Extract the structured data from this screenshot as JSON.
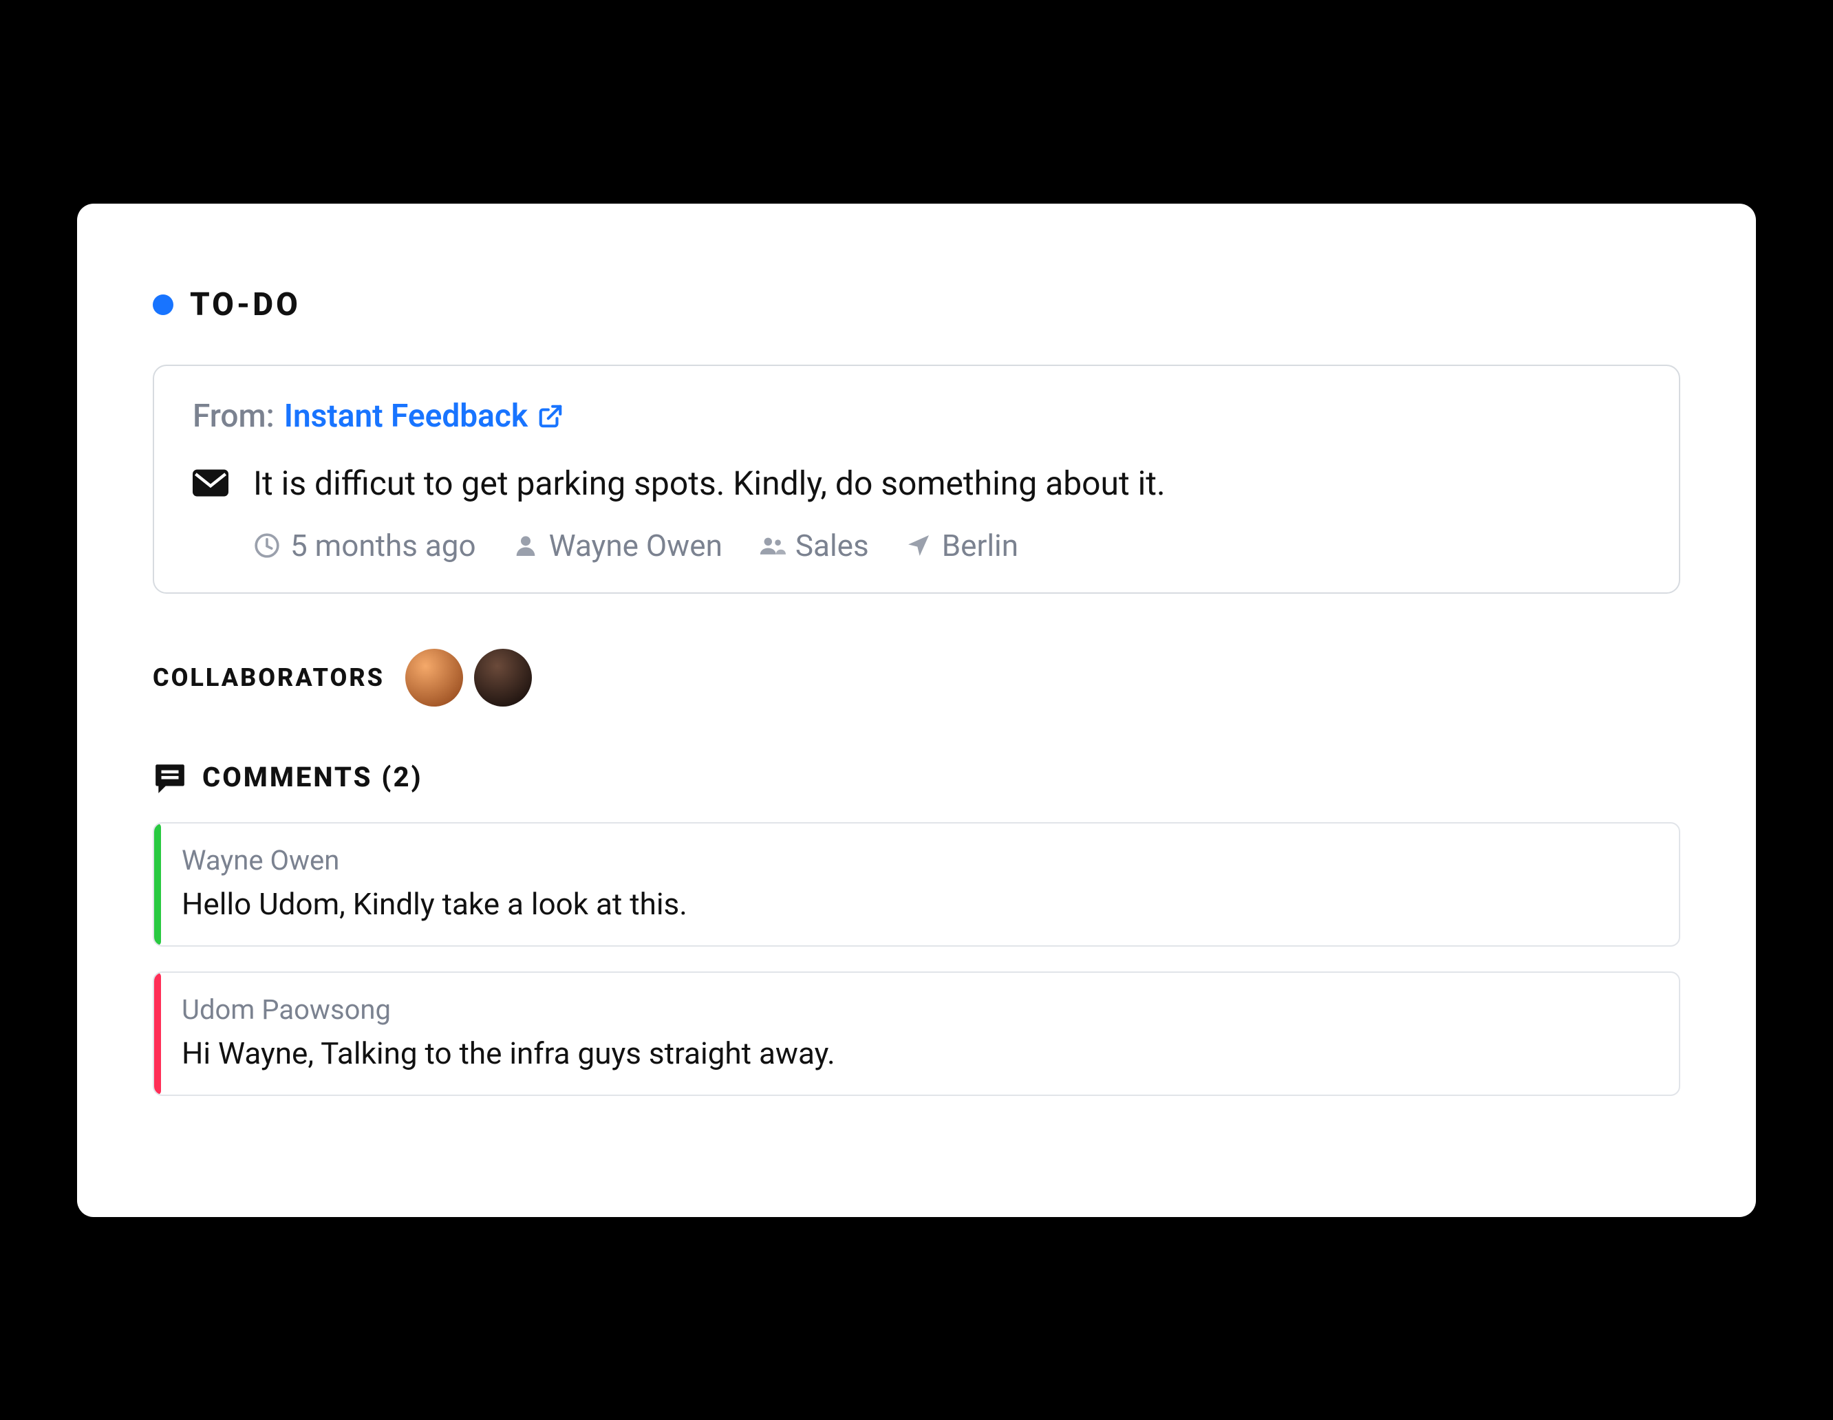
{
  "section": {
    "title": "TO-DO",
    "status_color": "#1874ff"
  },
  "feedback": {
    "from_label": "From:",
    "source_name": "Instant Feedback",
    "message": "It is difficut to get parking spots. Kindly, do something about it.",
    "meta": {
      "time": "5 months ago",
      "person": "Wayne Owen",
      "team": "Sales",
      "location": "Berlin"
    }
  },
  "collaborators": {
    "label": "COLLABORATORS",
    "people": [
      {
        "initials": ""
      },
      {
        "initials": ""
      }
    ]
  },
  "comments": {
    "label": "COMMENTS (2)",
    "items": [
      {
        "author": "Wayne Owen",
        "body": "Hello Udom, Kindly take a look at this.",
        "accent": "green"
      },
      {
        "author": "Udom Paowsong",
        "body": "Hi Wayne, Talking to the infra guys straight away.",
        "accent": "red"
      }
    ]
  }
}
